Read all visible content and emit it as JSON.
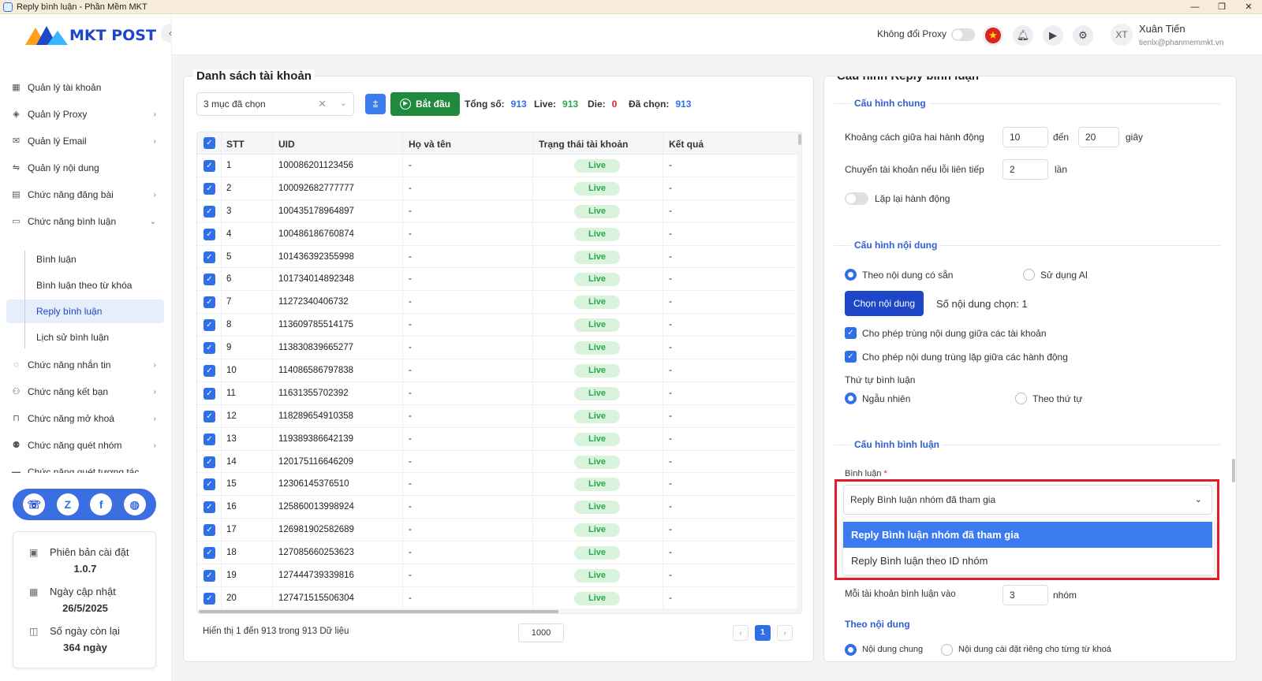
{
  "window": {
    "title": "Reply bình luận - Phần Mềm MKT",
    "minimize": "—",
    "maximize": "❐",
    "close": "✕"
  },
  "brand": {
    "name": "MKT POST",
    "colors": [
      "#ff9f1c",
      "#1e46c8",
      "#38b6ff"
    ]
  },
  "sidebar": {
    "items": [
      {
        "label": "Quản lý tài khoản",
        "icon": "grid-icon",
        "chevron": ""
      },
      {
        "label": "Quản lý Proxy",
        "icon": "layers-icon",
        "chevron": "›"
      },
      {
        "label": "Quản lý Email",
        "icon": "mail-icon",
        "chevron": "›"
      },
      {
        "label": "Quản lý nội dung",
        "icon": "link-icon",
        "chevron": ""
      },
      {
        "label": "Chức năng đăng bài",
        "icon": "post-icon",
        "chevron": "›"
      },
      {
        "label": "Chức năng bình luận",
        "icon": "comment-icon",
        "chevron": "⌄"
      }
    ],
    "subitems": [
      {
        "label": "Bình luận"
      },
      {
        "label": "Bình luận theo từ khóa"
      },
      {
        "label": "Reply bình luận"
      },
      {
        "label": "Lịch sử bình luận"
      }
    ],
    "items2": [
      {
        "label": "Chức năng nhắn tin",
        "icon": "chat-icon",
        "chevron": "›"
      },
      {
        "label": "Chức năng kết bạn",
        "icon": "add-friend-icon",
        "chevron": "›"
      },
      {
        "label": "Chức năng mở khoá",
        "icon": "unlock-icon",
        "chevron": "›"
      },
      {
        "label": "Chức năng quét nhóm",
        "icon": "group-icon",
        "chevron": "›"
      },
      {
        "label": "Chức năng quét tương tác",
        "icon": "scan-icon",
        "chevron": ""
      }
    ],
    "version_label": "Phiên bản cài đặt",
    "version": "1.0.7",
    "update_label": "Ngày cập nhật",
    "update_date": "26/5/2025",
    "days_label": "Số ngày còn lại",
    "days": "364 ngày"
  },
  "header": {
    "proxy_label": "Không đổi Proxy",
    "avatar": "XT",
    "user_name": "Xuân Tiến",
    "user_email": "tienlx@phanmemmkt.vn"
  },
  "accounts": {
    "title": "Danh sách tài khoản",
    "select_value": "3 mục đã chọn",
    "start_label": "Bắt đầu",
    "total_label": "Tổng số:",
    "total": "913",
    "live_label": "Live:",
    "live": "913",
    "die_label": "Die:",
    "die": "0",
    "selected_label": "Đã chọn:",
    "selected": "913",
    "columns": [
      "STT",
      "UID",
      "Họ và tên",
      "Trạng thái tài khoản",
      "Kết quả"
    ],
    "rows": [
      {
        "stt": "1",
        "uid": "100086201123456",
        "name": "-",
        "status": "Live",
        "result": "-"
      },
      {
        "stt": "2",
        "uid": "100092682777777",
        "name": "-",
        "status": "Live",
        "result": "-"
      },
      {
        "stt": "3",
        "uid": "100435178964897",
        "name": "-",
        "status": "Live",
        "result": "-"
      },
      {
        "stt": "4",
        "uid": "100486186760874",
        "name": "-",
        "status": "Live",
        "result": "-"
      },
      {
        "stt": "5",
        "uid": "101436392355998",
        "name": "-",
        "status": "Live",
        "result": "-"
      },
      {
        "stt": "6",
        "uid": "101734014892348",
        "name": "-",
        "status": "Live",
        "result": "-"
      },
      {
        "stt": "7",
        "uid": "11272340406732",
        "name": "-",
        "status": "Live",
        "result": "-"
      },
      {
        "stt": "8",
        "uid": "113609785514175",
        "name": "-",
        "status": "Live",
        "result": "-"
      },
      {
        "stt": "9",
        "uid": "113830839665277",
        "name": "-",
        "status": "Live",
        "result": "-"
      },
      {
        "stt": "10",
        "uid": "114086586797838",
        "name": "-",
        "status": "Live",
        "result": "-"
      },
      {
        "stt": "11",
        "uid": "11631355702392",
        "name": "-",
        "status": "Live",
        "result": "-"
      },
      {
        "stt": "12",
        "uid": "118289654910358",
        "name": "-",
        "status": "Live",
        "result": "-"
      },
      {
        "stt": "13",
        "uid": "119389386642139",
        "name": "-",
        "status": "Live",
        "result": "-"
      },
      {
        "stt": "14",
        "uid": "120175116646209",
        "name": "-",
        "status": "Live",
        "result": "-"
      },
      {
        "stt": "15",
        "uid": "12306145376510",
        "name": "-",
        "status": "Live",
        "result": "-"
      },
      {
        "stt": "16",
        "uid": "125860013998924",
        "name": "-",
        "status": "Live",
        "result": "-"
      },
      {
        "stt": "17",
        "uid": "126981902582689",
        "name": "-",
        "status": "Live",
        "result": "-"
      },
      {
        "stt": "18",
        "uid": "127085660253623",
        "name": "-",
        "status": "Live",
        "result": "-"
      },
      {
        "stt": "19",
        "uid": "127444739339816",
        "name": "-",
        "status": "Live",
        "result": "-"
      },
      {
        "stt": "20",
        "uid": "127471515506304",
        "name": "-",
        "status": "Live",
        "result": "-"
      }
    ],
    "footer": "Hiển thị 1 đến 913 trong 913 Dữ liệu",
    "page_size": "1000",
    "page": "1"
  },
  "config": {
    "title": "Cấu hình Reply bình luận",
    "general": {
      "title": "Cấu hình chung",
      "delay_label": "Khoảng cách giữa hai hành động",
      "delay_from": "10",
      "to_label": "đến",
      "delay_to": "20",
      "seconds": "giây",
      "switch_label": "Chuyển tài khoản nếu lỗi liên tiếp",
      "switch_value": "2",
      "times": "lần",
      "repeat_label": "Lặp lại hành động"
    },
    "content": {
      "title": "Cấu hình nội dung",
      "opt_available": "Theo nội dung có sẵn",
      "opt_ai": "Sử dụng AI",
      "choose_btn": "Chọn nội dung",
      "chosen": "Số nội dung chọn: 1",
      "chk1": "Cho phép trùng nội dung giữa các tài khoản",
      "chk2": "Cho phép nội dung trùng lặp giữa các hành động",
      "order_label": "Thứ tự bình luận",
      "random": "Ngẫu nhiên",
      "sequential": "Theo thứ tự"
    },
    "comment": {
      "title": "Cấu hình bình luận",
      "field_label": "Bình luận",
      "required": "*",
      "selected": "Reply Bình luận nhóm đã tham gia",
      "options": [
        "Reply Bình luận nhóm đã tham gia",
        "Reply Bình luận theo ID nhóm"
      ],
      "per_account_label": "Mỗi tài khoản bình luận vào",
      "per_account_value": "3",
      "group_unit": "nhóm",
      "by_content": "Theo nội dung",
      "opt_common": "Nội dung chung",
      "opt_keyword": "Nội dung cài đặt riêng cho từng từ khoá"
    }
  }
}
